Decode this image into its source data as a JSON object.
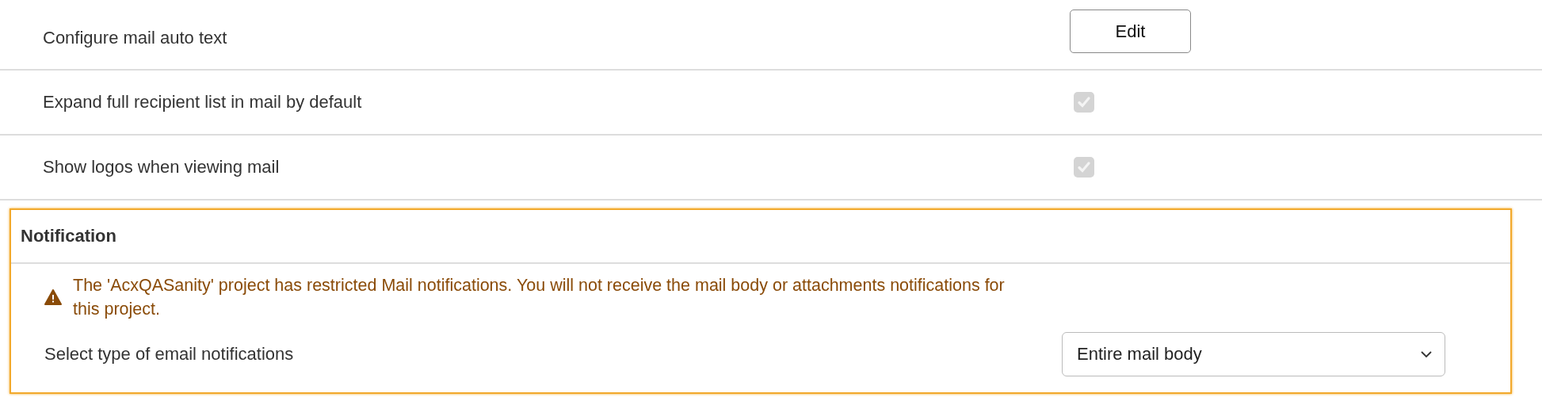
{
  "settings": [
    {
      "kind": "button",
      "label": "Configure mail auto text",
      "button": "Edit"
    },
    {
      "kind": "checkbox",
      "label": "Expand full recipient list in mail by default",
      "checked": true,
      "disabled": true
    },
    {
      "kind": "checkbox",
      "label": "Show logos when viewing mail",
      "checked": true,
      "disabled": true
    }
  ],
  "notification": {
    "title": "Notification",
    "focused": true,
    "warning": "The 'AcxQASanity' project has restricted Mail notifications. You will not receive the mail body or attachments notifications for this project.",
    "select_label": "Select type of email notifications",
    "select_value": "Entire mail body"
  }
}
